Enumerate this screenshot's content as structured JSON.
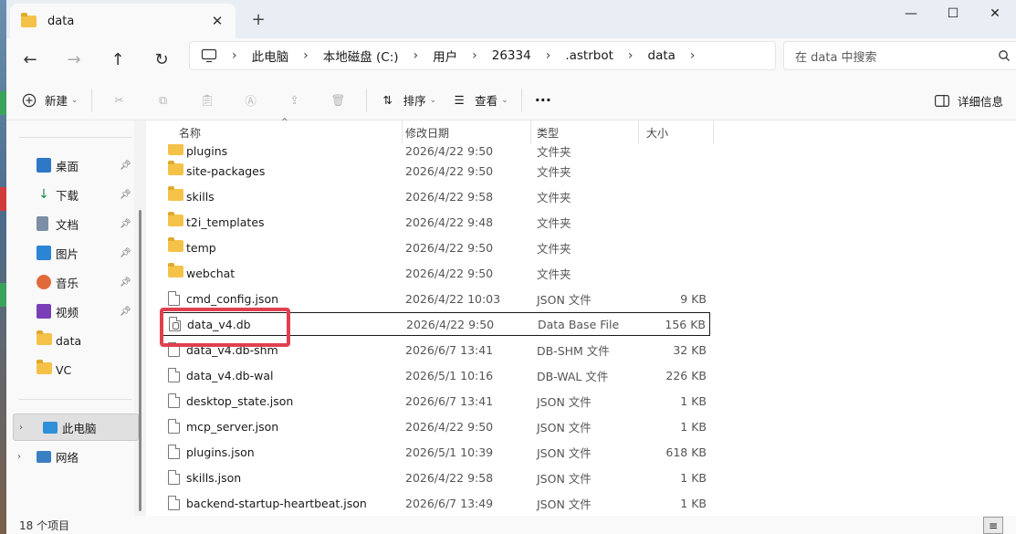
{
  "tab": {
    "title": "data",
    "close": "✕",
    "new_tab": "+"
  },
  "window_controls": {
    "minimize": "—",
    "maximize": "☐",
    "close": "✕"
  },
  "nav": {
    "back": "←",
    "forward": "→",
    "up": "↑",
    "refresh": "↻"
  },
  "address": {
    "breadcrumbs": [
      "此电脑",
      "本地磁盘 (C:)",
      "用户",
      "26334",
      ".astrbot",
      "data"
    ]
  },
  "search": {
    "placeholder": "在 data 中搜索"
  },
  "toolbar": {
    "new_label": "新建",
    "sort_label": "排序",
    "view_label": "查看",
    "more": "···",
    "details_label": "详细信息"
  },
  "sidebar": {
    "quick": [
      {
        "label": "桌面",
        "icon": "desktop-icon",
        "pinned": true
      },
      {
        "label": "下载",
        "icon": "download-icon",
        "pinned": true
      },
      {
        "label": "文档",
        "icon": "documents-icon",
        "pinned": true
      },
      {
        "label": "图片",
        "icon": "pictures-icon",
        "pinned": true
      },
      {
        "label": "音乐",
        "icon": "music-icon",
        "pinned": true
      },
      {
        "label": "视频",
        "icon": "videos-icon",
        "pinned": true
      },
      {
        "label": "data",
        "icon": "folder-icon",
        "pinned": false
      },
      {
        "label": "VC",
        "icon": "folder-icon",
        "pinned": false
      }
    ],
    "this_pc": "此电脑",
    "network": "网络"
  },
  "columns": {
    "name": "名称",
    "date": "修改日期",
    "type": "类型",
    "size": "大小"
  },
  "files": [
    {
      "name": "plugins",
      "date": "2026/4/22 9:50",
      "type": "文件夹",
      "size": "",
      "kind": "folder"
    },
    {
      "name": "site-packages",
      "date": "2026/4/22 9:50",
      "type": "文件夹",
      "size": "",
      "kind": "folder"
    },
    {
      "name": "skills",
      "date": "2026/4/22 9:58",
      "type": "文件夹",
      "size": "",
      "kind": "folder"
    },
    {
      "name": "t2i_templates",
      "date": "2026/4/22 9:48",
      "type": "文件夹",
      "size": "",
      "kind": "folder"
    },
    {
      "name": "temp",
      "date": "2026/4/22 9:50",
      "type": "文件夹",
      "size": "",
      "kind": "folder"
    },
    {
      "name": "webchat",
      "date": "2026/4/22 9:50",
      "type": "文件夹",
      "size": "",
      "kind": "folder"
    },
    {
      "name": "cmd_config.json",
      "date": "2026/4/22 10:03",
      "type": "JSON 文件",
      "size": "9 KB",
      "kind": "file"
    },
    {
      "name": "data_v4.db",
      "date": "2026/4/22 9:50",
      "type": "Data Base File",
      "size": "156 KB",
      "kind": "db"
    },
    {
      "name": "data_v4.db-shm",
      "date": "2026/6/7 13:41",
      "type": "DB-SHM 文件",
      "size": "32 KB",
      "kind": "file"
    },
    {
      "name": "data_v4.db-wal",
      "date": "2026/5/1 10:16",
      "type": "DB-WAL 文件",
      "size": "226 KB",
      "kind": "file"
    },
    {
      "name": "desktop_state.json",
      "date": "2026/6/7 13:41",
      "type": "JSON 文件",
      "size": "1 KB",
      "kind": "file"
    },
    {
      "name": "mcp_server.json",
      "date": "2026/4/22 9:50",
      "type": "JSON 文件",
      "size": "1 KB",
      "kind": "file"
    },
    {
      "name": "plugins.json",
      "date": "2026/5/1 10:39",
      "type": "JSON 文件",
      "size": "618 KB",
      "kind": "file"
    },
    {
      "name": "skills.json",
      "date": "2026/4/22 9:58",
      "type": "JSON 文件",
      "size": "1 KB",
      "kind": "file"
    },
    {
      "name": "backend-startup-heartbeat.json",
      "date": "2026/6/7 13:49",
      "type": "JSON 文件",
      "size": "1 KB",
      "kind": "file"
    }
  ],
  "status": {
    "count": "18 个项目"
  },
  "colors": {
    "highlight": "#e0404e",
    "folder": "#f5c249"
  }
}
